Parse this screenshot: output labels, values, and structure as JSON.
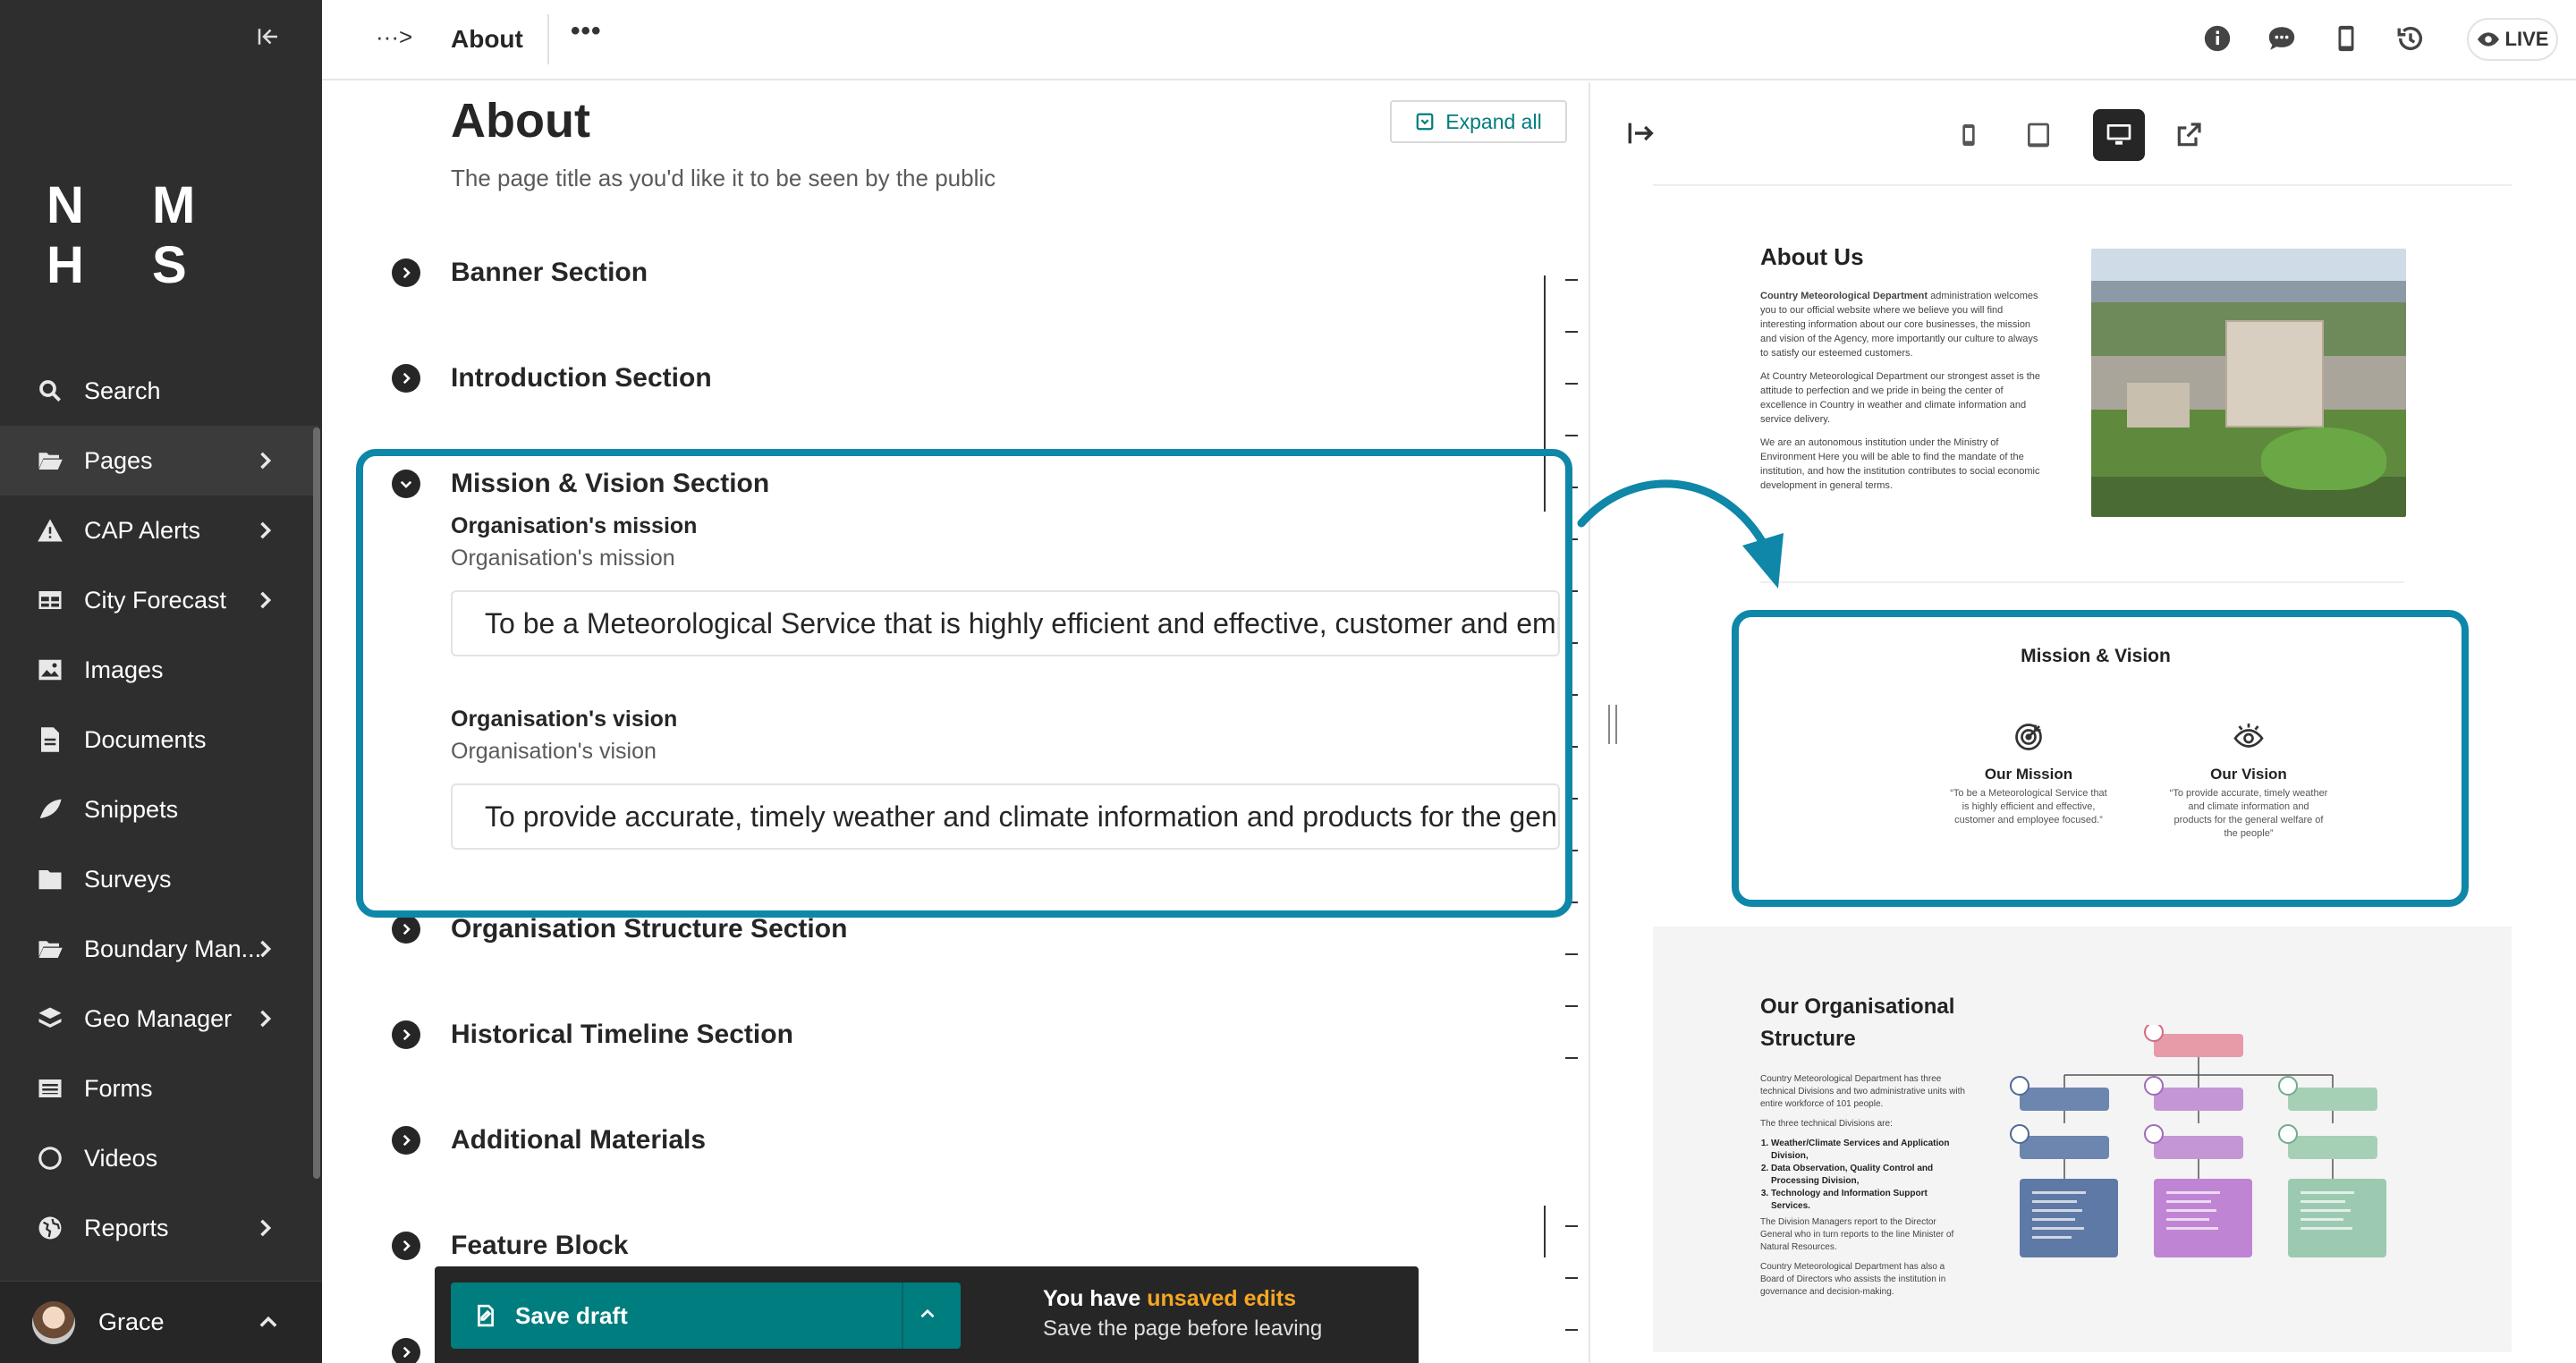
{
  "sidebar": {
    "logo": "N M H S",
    "items": [
      {
        "label": "Search",
        "icon": "search-icon",
        "has_submenu": false
      },
      {
        "label": "Pages",
        "icon": "folder-open-icon",
        "has_submenu": true,
        "active": true
      },
      {
        "label": "CAP Alerts",
        "icon": "warning-icon",
        "has_submenu": true
      },
      {
        "label": "City Forecast",
        "icon": "table-icon",
        "has_submenu": true
      },
      {
        "label": "Images",
        "icon": "image-icon",
        "has_submenu": false
      },
      {
        "label": "Documents",
        "icon": "document-icon",
        "has_submenu": false
      },
      {
        "label": "Snippets",
        "icon": "snippet-icon",
        "has_submenu": false
      },
      {
        "label": "Surveys",
        "icon": "folder-icon",
        "has_submenu": false
      },
      {
        "label": "Boundary Man...",
        "icon": "folder-open-icon",
        "has_submenu": true
      },
      {
        "label": "Geo Manager",
        "icon": "layers-icon",
        "has_submenu": true
      },
      {
        "label": "Forms",
        "icon": "list-icon",
        "has_submenu": false
      },
      {
        "label": "Videos",
        "icon": "circle-icon",
        "has_submenu": false
      },
      {
        "label": "Reports",
        "icon": "globe-icon",
        "has_submenu": true
      }
    ],
    "user": "Grace"
  },
  "header": {
    "breadcrumb_toggle": "···>",
    "title": "About",
    "more": "•••",
    "live_label": "LIVE"
  },
  "editor": {
    "page_title": "About",
    "page_help": "The page title as you'd like it to be seen by the public",
    "expand_all": "Expand all",
    "sections": [
      {
        "label": "Banner Section",
        "expanded": false
      },
      {
        "label": "Introduction Section",
        "expanded": false
      },
      {
        "label": "Mission & Vision Section",
        "expanded": true
      },
      {
        "label": "Organisation Structure Section",
        "expanded": false
      },
      {
        "label": "Historical Timeline Section",
        "expanded": false
      },
      {
        "label": "Additional Materials",
        "expanded": false
      },
      {
        "label": "Feature Block",
        "expanded": false
      }
    ],
    "mission": {
      "label": "Organisation's mission",
      "help": "Organisation's mission",
      "value": "To be a Meteorological Service that is highly efficient and effective, customer and employee focused."
    },
    "vision": {
      "label": "Organisation's vision",
      "help": "Organisation's vision",
      "value": "To provide accurate, timely weather and climate information and products for the general welfare of the people"
    }
  },
  "draftbar": {
    "save_label": "Save draft",
    "msg_prefix": "You have ",
    "msg_highlight": "unsaved edits",
    "msg_sub": "Save the page before leaving"
  },
  "preview": {
    "about": {
      "heading": "About Us",
      "p1_bold": "Country Meteorological Department",
      "p1_rest": " administration welcomes you to our official website where we believe you will find interesting information about our core businesses, the mission and vision of the Agency, more importantly our culture to always to satisfy our esteemed customers.",
      "p2": "At Country Meteorological Department our strongest asset is the attitude to perfection and we pride in being the center of excellence in Country in weather and climate information and service delivery.",
      "p3": "We are an autonomous institution under the Ministry of Environment Here you will be able to find the mandate of the institution, and how the institution contributes to social economic development in general terms."
    },
    "mission_vision": {
      "heading": "Mission & Vision",
      "mission_title": "Our Mission",
      "mission_text": "“To be a Meteorological Service that is highly efficient and effective, customer and employee focused.”",
      "vision_title": "Our Vision",
      "vision_text": "“To provide accurate, timely weather and climate information and products for the general welfare of the people”"
    },
    "org": {
      "heading": "Our Organisational Structure",
      "p1": "Country Meteorological Department has three technical Divisions and two administrative units with entire workforce of 101 people.",
      "p2": "The three technical Divisions are:",
      "divisions": [
        "Weather/Climate Services and Application Division,",
        "Data Observation, Quality Control and Processing Division,",
        "Technology and Information Support Services."
      ],
      "p3": "The Division Managers report to the Director General who in turn reports to the line Minister of Natural Resources.",
      "p4": "Country Meteorological Department has also a Board of Directors who assists the institution in governance and decision-making."
    }
  },
  "colors": {
    "sidebar_bg": "#2e2e2e",
    "accent_teal": "#007d7e",
    "highlight_blue": "#0e87a8",
    "warning": "#f5a623"
  }
}
